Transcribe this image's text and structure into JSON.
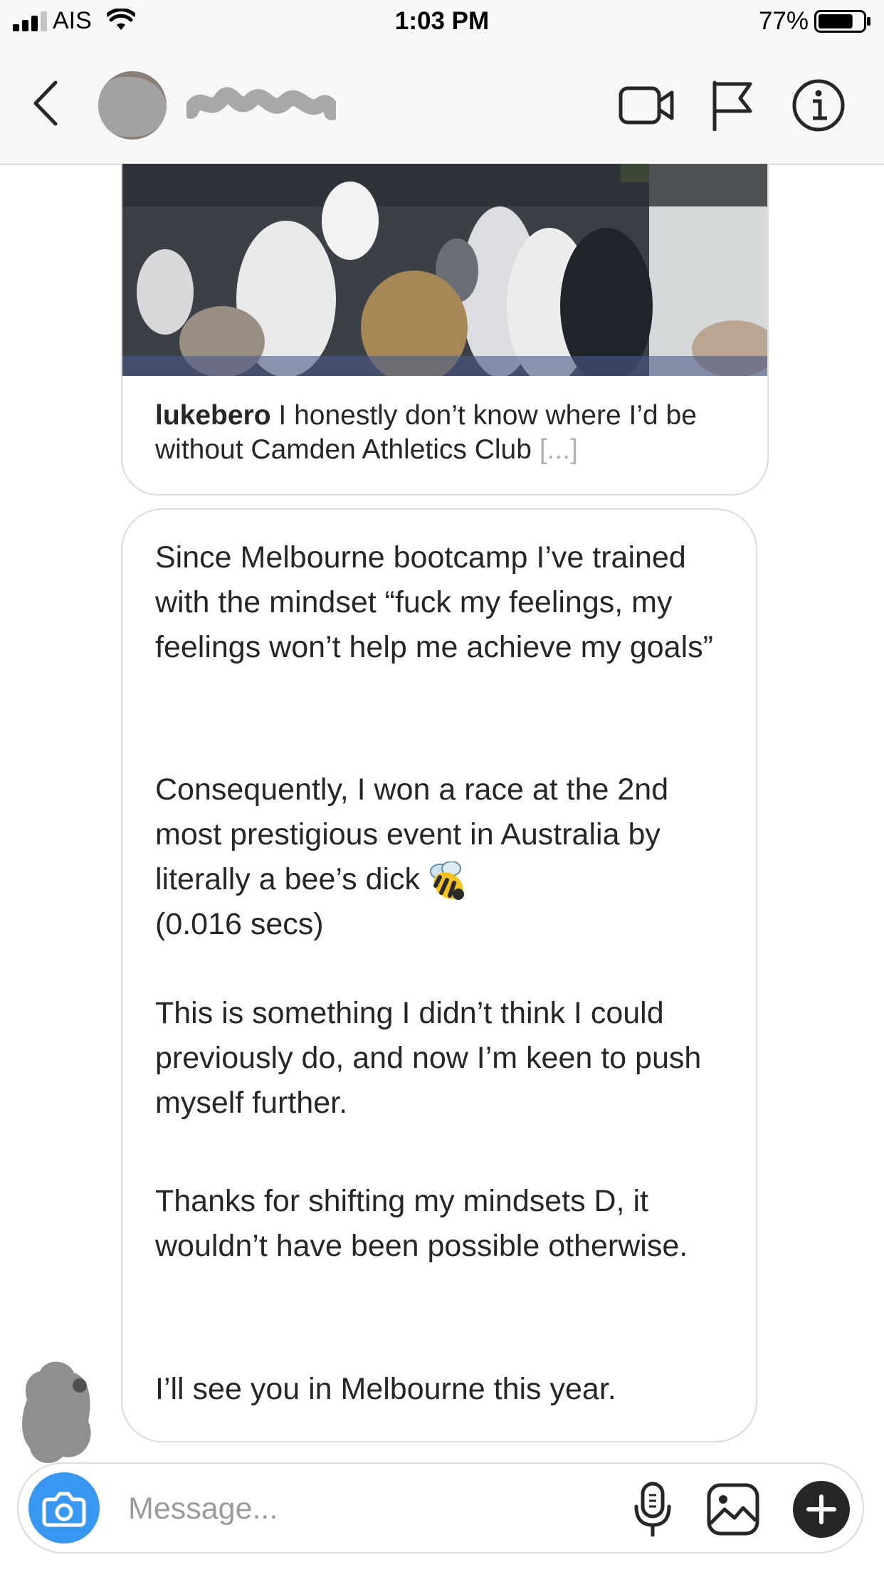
{
  "status_bar": {
    "carrier": "AIS",
    "time": "1:03 PM",
    "battery_percent": "77%",
    "battery_level": 0.77
  },
  "header": {
    "back_icon": "chevron-left-icon",
    "video_icon": "video-camera-icon",
    "flag_icon": "flag-icon",
    "info_icon": "info-icon"
  },
  "shared_post": {
    "username": "lukebero",
    "caption": " I honestly don’t know where I’d be without Camden Athletics Club ",
    "ellipsis": "[...]"
  },
  "message": {
    "paragraphs": [
      "Since Melbourne bootcamp I’ve trained with the mindset “fuck my feelings, my feelings won’t help me achieve my goals”",
      "Consequently, I won a race at the 2nd most prestigious event in Australia by literally a bee’s dick",
      "(0.016 secs)",
      "This is something I didn’t think I could previously do, and now I’m keen to push myself further.",
      "Thanks for shifting my mindsets D, it wouldn’t have been possible otherwise.",
      "I’ll see you in Melbourne this year."
    ],
    "emoji": "bee-emoji"
  },
  "composer": {
    "placeholder": "Message...",
    "camera_icon": "camera-icon",
    "mic_icon": "microphone-icon",
    "gallery_icon": "gallery-icon",
    "plus_icon": "plus-icon"
  },
  "colors": {
    "accent_blue": "#3897f0",
    "border": "#dbdbdb",
    "text": "#262626",
    "placeholder": "#9b9b9b"
  }
}
